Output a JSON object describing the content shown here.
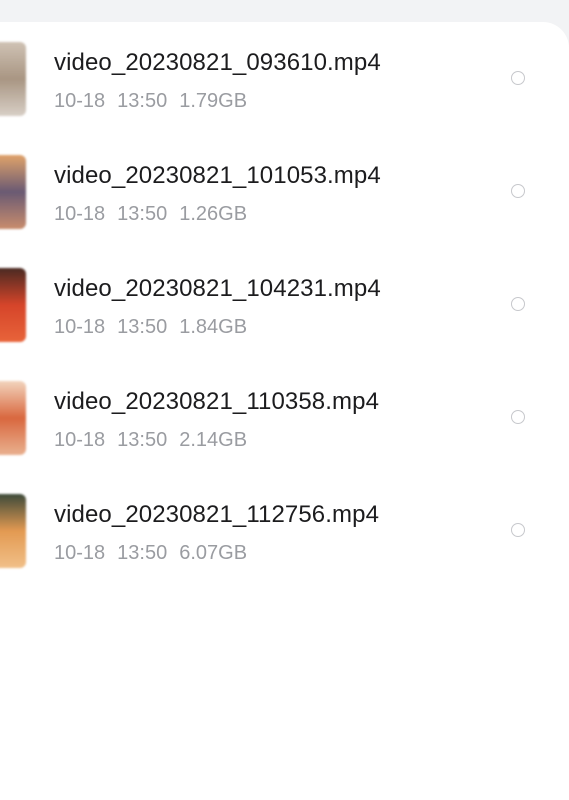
{
  "files": [
    {
      "name": "video_20230821_093610.mp4",
      "date": "10-18",
      "time": "13:50",
      "size": "1.79GB",
      "thumb_colors": [
        "#cfc2b4",
        "#a99683",
        "#d8cfc6"
      ]
    },
    {
      "name": "video_20230821_101053.mp4",
      "date": "10-18",
      "time": "13:50",
      "size": "1.26GB",
      "thumb_colors": [
        "#e0a26a",
        "#6a5a73",
        "#c98d6d"
      ]
    },
    {
      "name": "video_20230821_104231.mp4",
      "date": "10-18",
      "time": "13:50",
      "size": "1.84GB",
      "thumb_colors": [
        "#4a2a22",
        "#d6452a",
        "#e8643a"
      ]
    },
    {
      "name": "video_20230821_110358.mp4",
      "date": "10-18",
      "time": "13:50",
      "size": "2.14GB",
      "thumb_colors": [
        "#f2d4bd",
        "#d9683f",
        "#e9b08f"
      ]
    },
    {
      "name": "video_20230821_112756.mp4",
      "date": "10-18",
      "time": "13:50",
      "size": "6.07GB",
      "thumb_colors": [
        "#3d4a3a",
        "#e39a52",
        "#f1c089"
      ]
    }
  ]
}
